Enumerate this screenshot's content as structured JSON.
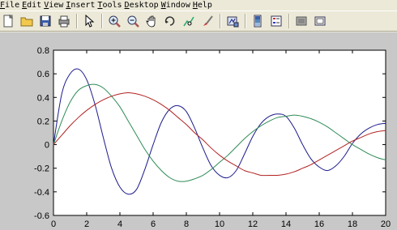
{
  "menubar": {
    "items": [
      "File",
      "Edit",
      "View",
      "Insert",
      "Tools",
      "Desktop",
      "Window",
      "Help"
    ]
  },
  "toolbar": {
    "buttons": [
      "new-figure-icon",
      "open-file-icon",
      "save-icon",
      "print-icon",
      "edit-plot-arrow-icon",
      "zoom-in-icon",
      "zoom-out-icon",
      "pan-hand-icon",
      "rotate-3d-icon",
      "data-cursor-icon",
      "brush-icon",
      "link-plot-icon",
      "colorbar-icon",
      "legend-icon",
      "hide-plot-tools-icon",
      "show-plot-tools-icon"
    ]
  },
  "colors": {
    "window_bg": "#ece9d8",
    "figure_bg": "#c8c8c8",
    "axes_bg": "#ffffff",
    "series_blue": "#1a1a8c",
    "series_green": "#2e8b57",
    "series_red": "#b22222"
  },
  "chart_data": {
    "type": "line",
    "title": "",
    "xlabel": "",
    "ylabel": "",
    "xlim": [
      0,
      20
    ],
    "ylim": [
      -0.6,
      0.8
    ],
    "xticks": [
      "0",
      "2",
      "4",
      "6",
      "8",
      "10",
      "12",
      "14",
      "16",
      "18",
      "20"
    ],
    "yticks": [
      "-0.6",
      "-0.4",
      "-0.2",
      "0",
      "0.2",
      "0.4",
      "0.6",
      "0.8"
    ],
    "grid": false,
    "series": [
      {
        "color": "#1a1a8c",
        "x": [
          0,
          0.5,
          1,
          1.5,
          2,
          2.5,
          3,
          3.5,
          4,
          4.5,
          5,
          5.5,
          6,
          6.5,
          7,
          7.5,
          8,
          8.5,
          9,
          9.5,
          10,
          10.5,
          11,
          11.5,
          12,
          12.5,
          13,
          13.5,
          14,
          14.5,
          15,
          15.5,
          16,
          16.5,
          17,
          17.5,
          18,
          18.5,
          19,
          19.5,
          20
        ],
        "y": [
          0,
          0.43,
          0.6,
          0.64,
          0.55,
          0.34,
          0.06,
          -0.2,
          -0.36,
          -0.42,
          -0.38,
          -0.21,
          0.0,
          0.19,
          0.3,
          0.33,
          0.28,
          0.14,
          -0.03,
          -0.18,
          -0.26,
          -0.28,
          -0.22,
          -0.08,
          0.07,
          0.18,
          0.24,
          0.26,
          0.24,
          0.14,
          0.0,
          -0.12,
          -0.19,
          -0.22,
          -0.18,
          -0.1,
          0.01,
          0.09,
          0.14,
          0.17,
          0.18
        ]
      },
      {
        "color": "#2e8b57",
        "x": [
          0,
          0.5,
          1,
          1.5,
          2,
          2.5,
          3,
          3.5,
          4,
          4.5,
          5,
          5.5,
          6,
          6.5,
          7,
          7.5,
          8,
          8.5,
          9,
          9.5,
          10,
          10.5,
          11,
          11.5,
          12,
          12.5,
          13,
          13.5,
          14,
          14.5,
          15,
          15.5,
          16,
          16.5,
          17,
          17.5,
          18,
          18.5,
          19,
          19.5,
          20
        ],
        "y": [
          0,
          0.2,
          0.36,
          0.46,
          0.5,
          0.51,
          0.48,
          0.41,
          0.32,
          0.2,
          0.08,
          -0.04,
          -0.14,
          -0.22,
          -0.28,
          -0.31,
          -0.31,
          -0.29,
          -0.26,
          -0.21,
          -0.15,
          -0.09,
          -0.02,
          0.05,
          0.11,
          0.16,
          0.2,
          0.23,
          0.24,
          0.25,
          0.24,
          0.22,
          0.19,
          0.15,
          0.1,
          0.05,
          0.0,
          -0.04,
          -0.08,
          -0.11,
          -0.13
        ]
      },
      {
        "color": "#b22222",
        "x": [
          0,
          0.5,
          1,
          1.5,
          2,
          2.5,
          3,
          3.5,
          4,
          4.5,
          5,
          5.5,
          6,
          6.5,
          7,
          7.5,
          8,
          8.5,
          9,
          9.5,
          10,
          10.5,
          11,
          11.5,
          12,
          12.5,
          13,
          13.5,
          14,
          14.5,
          15,
          15.5,
          16,
          16.5,
          17,
          17.5,
          18,
          18.5,
          19,
          19.5,
          20
        ],
        "y": [
          0,
          0.08,
          0.16,
          0.23,
          0.29,
          0.34,
          0.38,
          0.41,
          0.43,
          0.44,
          0.43,
          0.41,
          0.38,
          0.34,
          0.29,
          0.23,
          0.17,
          0.1,
          0.04,
          -0.03,
          -0.09,
          -0.14,
          -0.18,
          -0.22,
          -0.24,
          -0.26,
          -0.26,
          -0.26,
          -0.25,
          -0.23,
          -0.2,
          -0.17,
          -0.13,
          -0.09,
          -0.05,
          -0.01,
          0.03,
          0.06,
          0.09,
          0.11,
          0.12
        ]
      }
    ]
  }
}
